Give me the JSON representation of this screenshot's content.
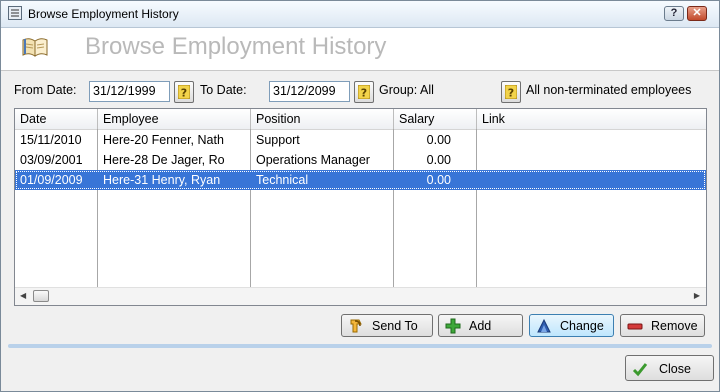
{
  "window": {
    "title": "Browse Employment History",
    "help_glyph": "?",
    "close_glyph": "✕"
  },
  "banner": {
    "title": "Browse Employment History",
    "icon": "open-book-icon"
  },
  "filters": {
    "from_label": "From Date:",
    "from_value": "31/12/1999",
    "to_label": "To Date:",
    "to_value": "31/12/2099",
    "group_text": "Group: All",
    "scope_text": "All non-terminated employees",
    "lookup_icon": "question-mark-icon"
  },
  "table": {
    "columns": [
      "Date",
      "Employee",
      "Position",
      "Salary",
      "Link"
    ],
    "rows": [
      {
        "date": "15/11/2010",
        "employee": "Here-20 Fenner, Nath",
        "position": "Support",
        "salary": "0.00",
        "link": ""
      },
      {
        "date": "03/09/2001",
        "employee": "Here-28 De Jager, Ro",
        "position": "Operations Manager",
        "salary": "0.00",
        "link": ""
      },
      {
        "date": "01/09/2009",
        "employee": "Here-31 Henry, Ryan",
        "position": "Technical",
        "salary": "0.00",
        "link": "",
        "selected": true
      }
    ]
  },
  "buttons": {
    "send_to": "Send To",
    "add": "Add",
    "change": "Change",
    "remove": "Remove",
    "close": "Close"
  },
  "colors": {
    "selection": "#3875d7",
    "banner_title": "#b9b9b9",
    "separator": "#b9d1ea"
  }
}
